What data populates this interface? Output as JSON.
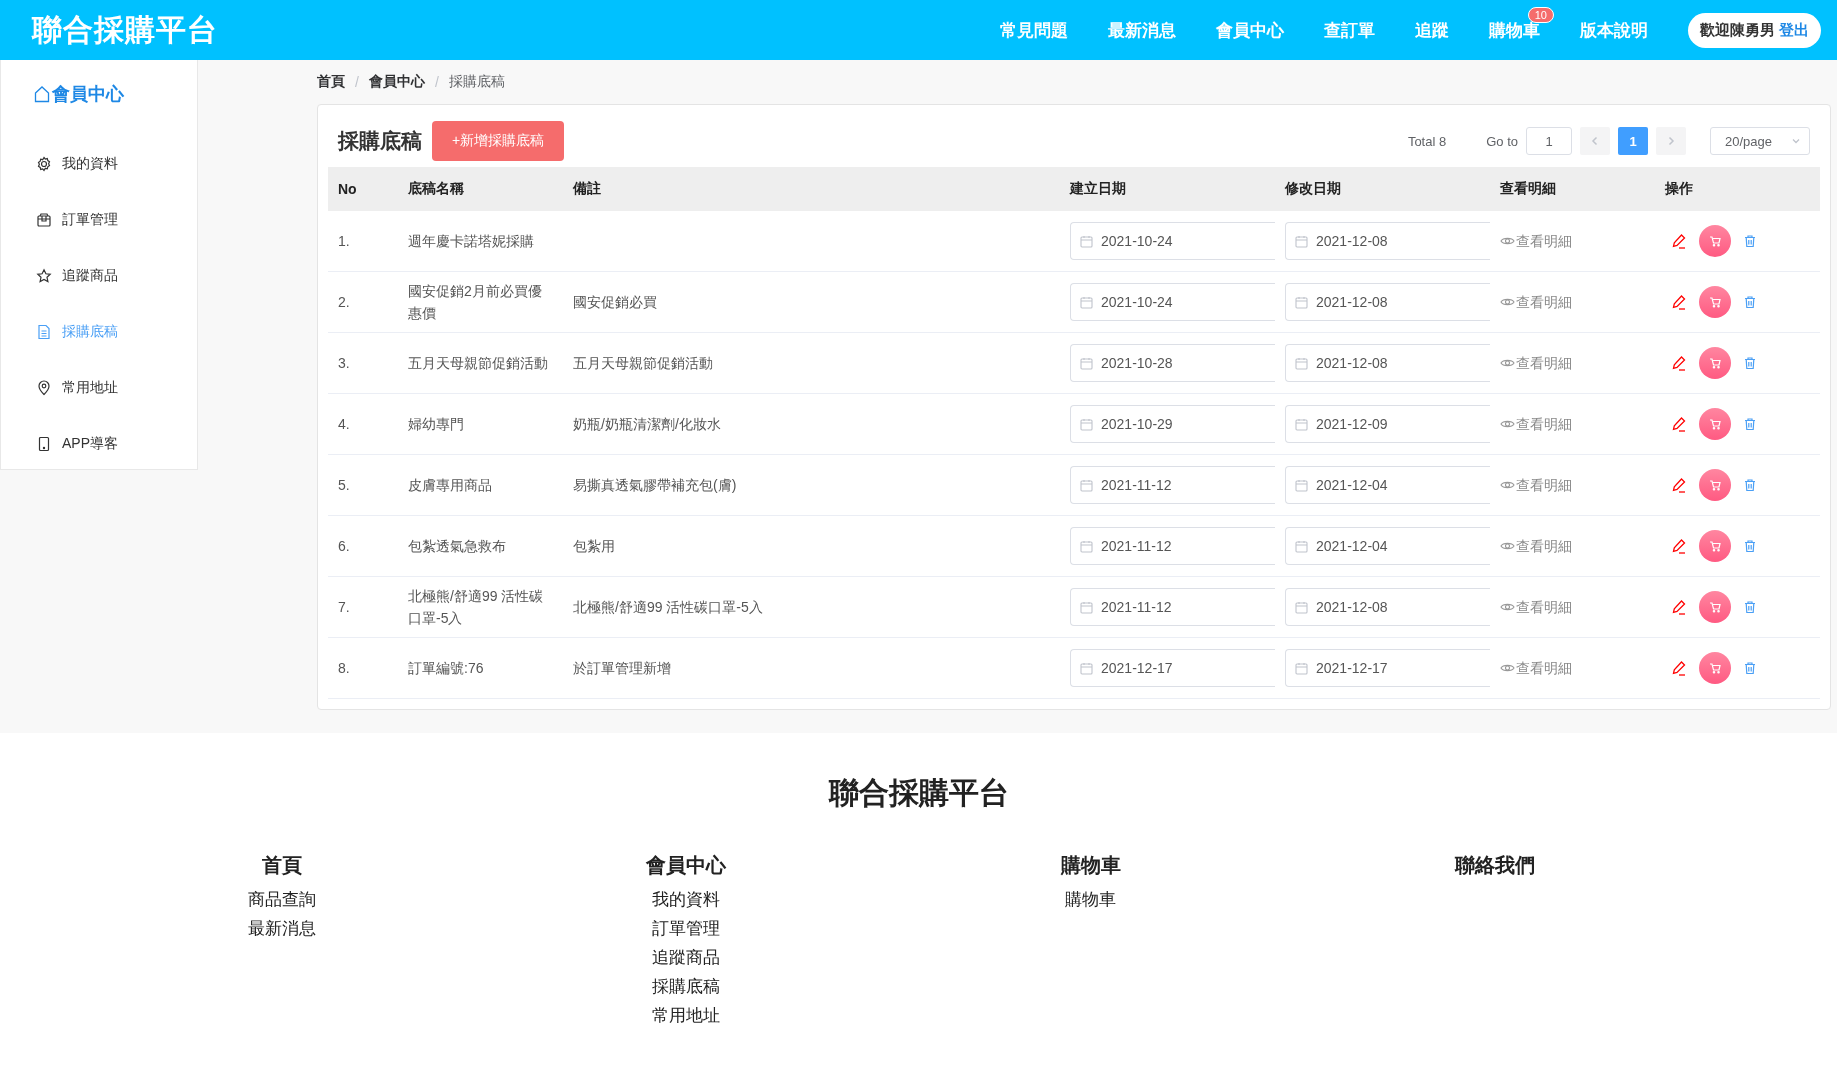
{
  "header": {
    "logo": "聯合採購平台",
    "nav": [
      {
        "label": "常見問題"
      },
      {
        "label": "最新消息"
      },
      {
        "label": "會員中心"
      },
      {
        "label": "查訂單"
      },
      {
        "label": "追蹤"
      },
      {
        "label": "購物車",
        "badge": "10"
      },
      {
        "label": "版本說明"
      }
    ],
    "welcome": "歡迎陳勇男",
    "logout": "登出"
  },
  "sidebar": {
    "title": "會員中心",
    "items": [
      {
        "label": "我的資料",
        "selected": false
      },
      {
        "label": "訂單管理",
        "selected": false
      },
      {
        "label": "追蹤商品",
        "selected": false
      },
      {
        "label": "採購底稿",
        "selected": true
      },
      {
        "label": "常用地址",
        "selected": false
      },
      {
        "label": "APP導客",
        "selected": false
      }
    ]
  },
  "breadcrumb": {
    "items": [
      "首頁",
      "會員中心",
      "採購底稿"
    ],
    "separator": "/"
  },
  "panel": {
    "title": "採購底稿",
    "add_button": "+新增採購底稿",
    "pagination": {
      "total": "Total 8",
      "goto_label": "Go to",
      "goto_value": "1",
      "pages": [
        {
          "label": "1",
          "selected": true
        }
      ],
      "page_size": "20/page"
    }
  },
  "table": {
    "columns": [
      "No",
      "底稿名稱",
      "備註",
      "建立日期",
      "修改日期",
      "查看明細",
      "操作"
    ],
    "rows": [
      {
        "no": "1.",
        "name": "週年慶卡諾塔妮採購",
        "note": "",
        "created": "2021-10-24",
        "modified": "2021-12-08",
        "detail": "查看明細"
      },
      {
        "no": "2.",
        "name": "國安促銷2月前必買優惠價",
        "note": "國安促銷必買",
        "created": "2021-10-24",
        "modified": "2021-12-08",
        "detail": "查看明細"
      },
      {
        "no": "3.",
        "name": "五月天母親節促銷活動",
        "note": "五月天母親節促銷活動",
        "created": "2021-10-28",
        "modified": "2021-12-08",
        "detail": "查看明細"
      },
      {
        "no": "4.",
        "name": "婦幼專門",
        "note": "奶瓶/奶瓶清潔劑/化妝水",
        "created": "2021-10-29",
        "modified": "2021-12-09",
        "detail": "查看明細"
      },
      {
        "no": "5.",
        "name": "皮膚專用商品",
        "note": "易撕真透氣膠帶補充包(膚)",
        "created": "2021-11-12",
        "modified": "2021-12-04",
        "detail": "查看明細"
      },
      {
        "no": "6.",
        "name": "包紮透氣急救布",
        "note": "包紮用",
        "created": "2021-11-12",
        "modified": "2021-12-04",
        "detail": "查看明細"
      },
      {
        "no": "7.",
        "name": "北極熊/舒適99 活性碳口罩-5入",
        "note": "北極熊/舒適99 活性碳口罩-5入",
        "created": "2021-11-12",
        "modified": "2021-12-08",
        "detail": "查看明細"
      },
      {
        "no": "8.",
        "name": "訂單編號:76",
        "note": "於訂單管理新增",
        "created": "2021-12-17",
        "modified": "2021-12-17",
        "detail": "查看明細"
      }
    ]
  },
  "footer": {
    "title": "聯合採購平台",
    "columns": [
      {
        "heading": "首頁",
        "links": [
          "商品查詢",
          "最新消息"
        ]
      },
      {
        "heading": "會員中心",
        "links": [
          "我的資料",
          "訂單管理",
          "追蹤商品",
          "採購底稿",
          "常用地址"
        ]
      },
      {
        "heading": "購物車",
        "links": [
          "購物車"
        ]
      },
      {
        "heading": "聯絡我們"
      }
    ]
  }
}
